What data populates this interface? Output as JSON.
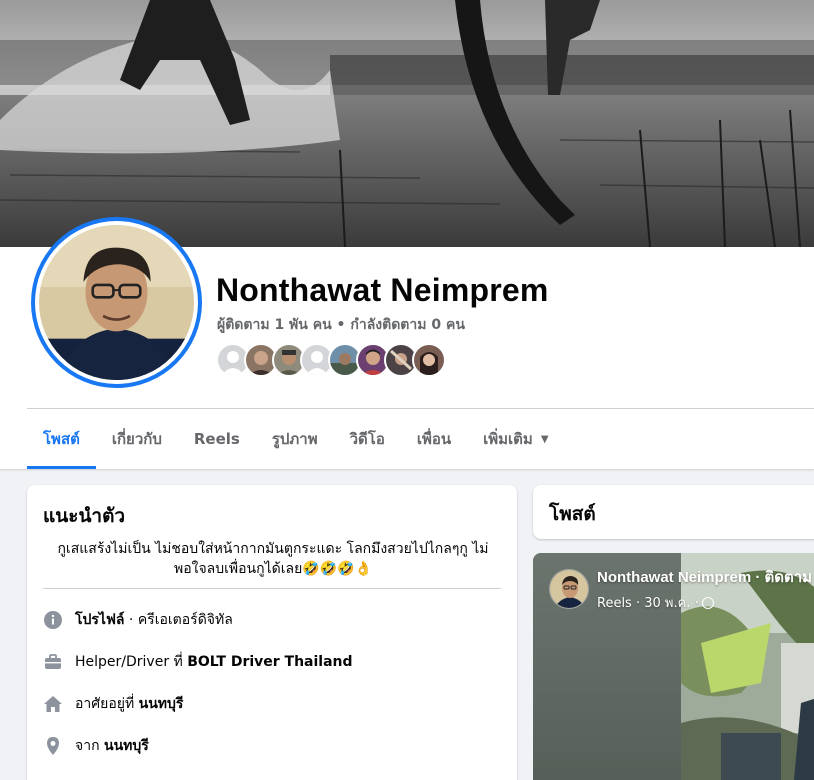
{
  "profile": {
    "name": "Nonthawat Neimprem",
    "follow_stats": "ผู้ติดตาม 1 พัน คน • กำลังติดตาม 0 คน"
  },
  "tabs": [
    {
      "label": "โพสต์",
      "active": true
    },
    {
      "label": "เกี่ยวกับ"
    },
    {
      "label": "Reels"
    },
    {
      "label": "รูปภาพ"
    },
    {
      "label": "วิดีโอ"
    },
    {
      "label": "เพื่อน"
    },
    {
      "label": "เพิ่มเติม",
      "dropdown": true
    }
  ],
  "intro": {
    "title": "แนะนำตัว",
    "bio_line1": "กูเสแสร้งไม่เป็น ไม่ชอบใส่หน้ากากมันตูกระแดะ โลกมึงสวยไปไกลๆกู ไม่",
    "bio_line2": "พอใจลบเพื่อนกูได้เลย🤣🤣🤣👌",
    "items": [
      {
        "icon": "info-icon",
        "prefix": "",
        "bold": "โปรไฟล์",
        "suffix": " · ครีเอเตอร์ดิจิทัล"
      },
      {
        "icon": "briefcase-icon",
        "prefix": "Helper/Driver ที่ ",
        "bold": "BOLT Driver Thailand",
        "suffix": ""
      },
      {
        "icon": "home-icon",
        "prefix": "อาศัยอยู่ที่ ",
        "bold": "นนทบุรี",
        "suffix": ""
      },
      {
        "icon": "location-pin-icon",
        "prefix": "จาก ",
        "bold": "นนทบุรี",
        "suffix": ""
      }
    ]
  },
  "posts": {
    "title": "โพสต์",
    "first_post": {
      "author": "Nonthawat Neimprem · ติดตาม",
      "meta": "Reels · 30 พ.ค. ·"
    }
  },
  "colors": {
    "accent": "#1877f2",
    "text_secondary": "#65676b",
    "background": "#f0f2f5"
  }
}
